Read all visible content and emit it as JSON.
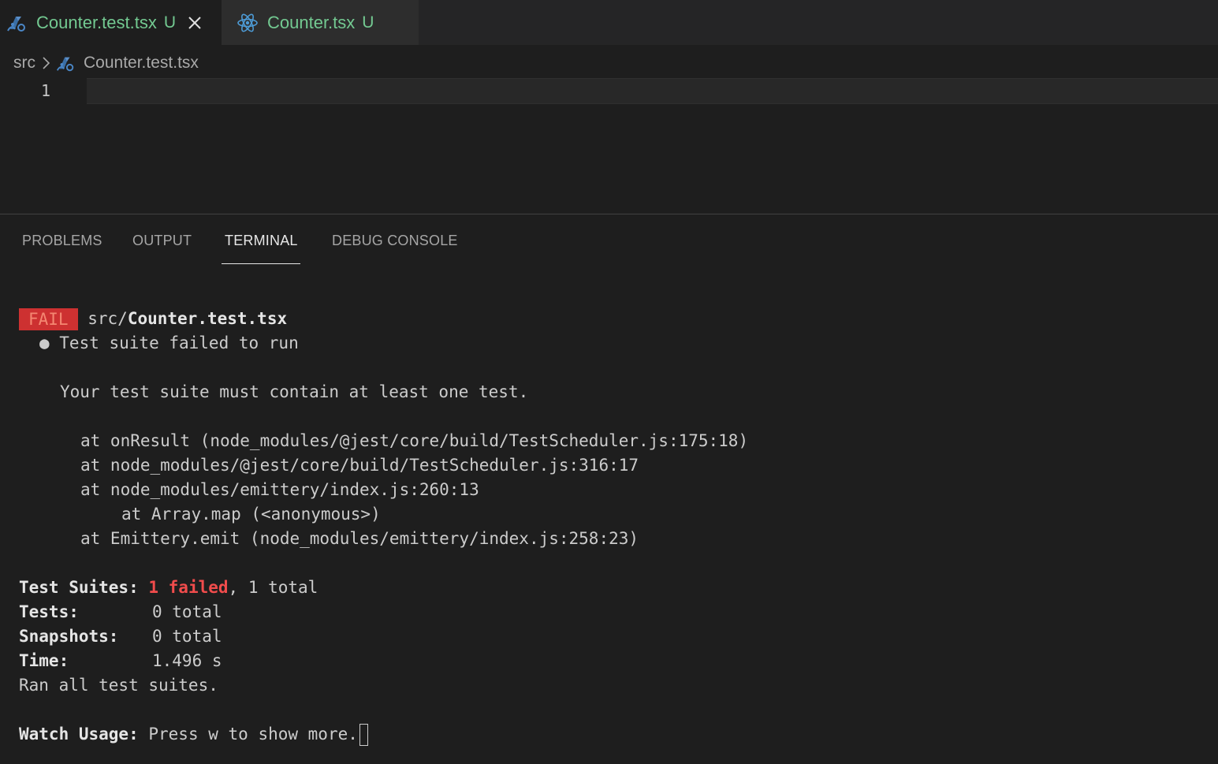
{
  "tabs": [
    {
      "name": "Counter.test.tsx",
      "status": "U",
      "icon": "jest-icon"
    },
    {
      "name": "Counter.tsx",
      "status": "U",
      "icon": "react-icon"
    }
  ],
  "breadcrumb": {
    "folder": "src",
    "file": "Counter.test.tsx"
  },
  "editor": {
    "line_number": "1"
  },
  "panel": {
    "tabs": [
      "PROBLEMS",
      "OUTPUT",
      "TERMINAL",
      "DEBUG CONSOLE"
    ],
    "active_tab": "TERMINAL"
  },
  "terminal": {
    "fail_badge": "FAIL",
    "path_prefix": "src/",
    "path_file": "Counter.test.tsx",
    "suite_error": "● Test suite failed to run",
    "error_message": "Your test suite must contain at least one test.",
    "stack": [
      "at onResult (node_modules/@jest/core/build/TestScheduler.js:175:18)",
      "at node_modules/@jest/core/build/TestScheduler.js:316:17",
      "at node_modules/emittery/index.js:260:13",
      "at Array.map (<anonymous>)",
      "at Emittery.emit (node_modules/emittery/index.js:258:23)"
    ],
    "summary": {
      "suites_label": "Test Suites:",
      "suites_failed": "1 failed",
      "suites_rest": ", 1 total",
      "tests_label": "Tests:",
      "tests_value": "0 total",
      "snapshots_label": "Snapshots:",
      "snapshots_value": "0 total",
      "time_label": "Time:",
      "time_value": "1.496 s",
      "ran": "Ran all test suites."
    },
    "watch_label": "Watch Usage:",
    "watch_text": "Press w to show more."
  },
  "colors": {
    "editor_bg": "#1e1e1e",
    "tabbar_bg": "#252526",
    "untracked_green": "#73c991",
    "fail_red": "#cd3131",
    "error_text": "#f14c4c"
  }
}
